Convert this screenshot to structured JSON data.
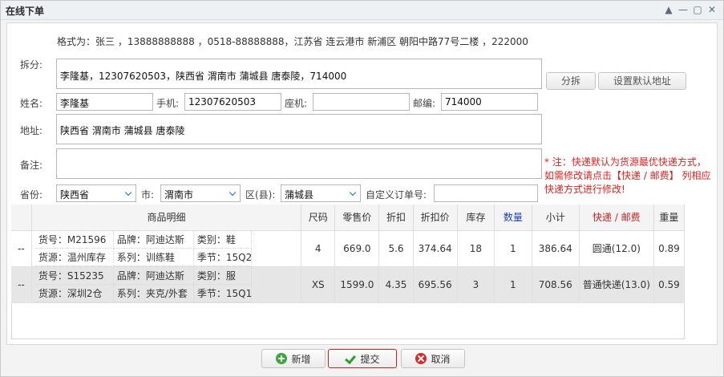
{
  "window": {
    "title": "在线下单"
  },
  "form": {
    "hint": "格式为：张三 ，13888888888 ，0518-88888888，江苏省 连云港市 新浦区 朝阳中路77号二楼 ，222000",
    "split_label": "拆分:",
    "split_value": "李隆基，12307620503，陕西省 渭南市 蒲城县 唐泰陵，714000",
    "split_button": "分拆",
    "default_addr_button": "设置默认地址",
    "name_label": "姓名:",
    "name_value": "李隆基",
    "mobile_label": "手机:",
    "mobile_value": "12307620503",
    "phone_label": "座机:",
    "phone_value": "",
    "zip_label": "邮编:",
    "zip_value": "714000",
    "address_label": "地址:",
    "address_value": "陕西省 渭南市 蒲城县 唐泰陵",
    "remark_label": "备注:",
    "remark_value": "",
    "province_label": "省份:",
    "province_value": "陕西省",
    "city_label": "市:",
    "city_value": "渭南市",
    "district_label": "区(县):",
    "district_value": "蒲城县",
    "custom_order_label": "自定义订单号:",
    "custom_order_value": "",
    "note": "* 注：快递默认为货源最优快递方式，如需修改请点击【快递 / 邮费】 列相应快递方式进行修改!"
  },
  "table": {
    "headers": [
      "",
      "商品明细",
      "尺码",
      "零售价",
      "折扣",
      "折扣价",
      "库存",
      "数量",
      "小计",
      "快递 / 邮费",
      "重量"
    ],
    "rows": [
      {
        "mark": "--",
        "code": "货号：M21596",
        "brand": "品牌：阿迪达斯",
        "category": "类别：鞋",
        "source": "货源：温州库存",
        "series": "系列：训练鞋",
        "season": "季节：15Q2",
        "size": "4",
        "retail": "669.0",
        "discount": "5.6",
        "discount_price": "374.64",
        "stock": "18",
        "qty": "1",
        "subtotal": "386.64",
        "shipping": "圆通(12.0)",
        "weight": "0.89"
      },
      {
        "mark": "--",
        "code": "货号：S15235",
        "brand": "品牌：阿迪达斯",
        "category": "类别：服",
        "source": "货源：深圳2仓",
        "series": "系列：夹克/外套",
        "season": "季节：15Q1",
        "size": "XS",
        "retail": "1599.0",
        "discount": "4.35",
        "discount_price": "695.56",
        "stock": "3",
        "qty": "1",
        "subtotal": "708.56",
        "shipping": "普通快递(13.0)",
        "weight": "0.59"
      }
    ]
  },
  "footer": {
    "add_label": "新增",
    "submit_label": "提交",
    "cancel_label": "取消"
  }
}
